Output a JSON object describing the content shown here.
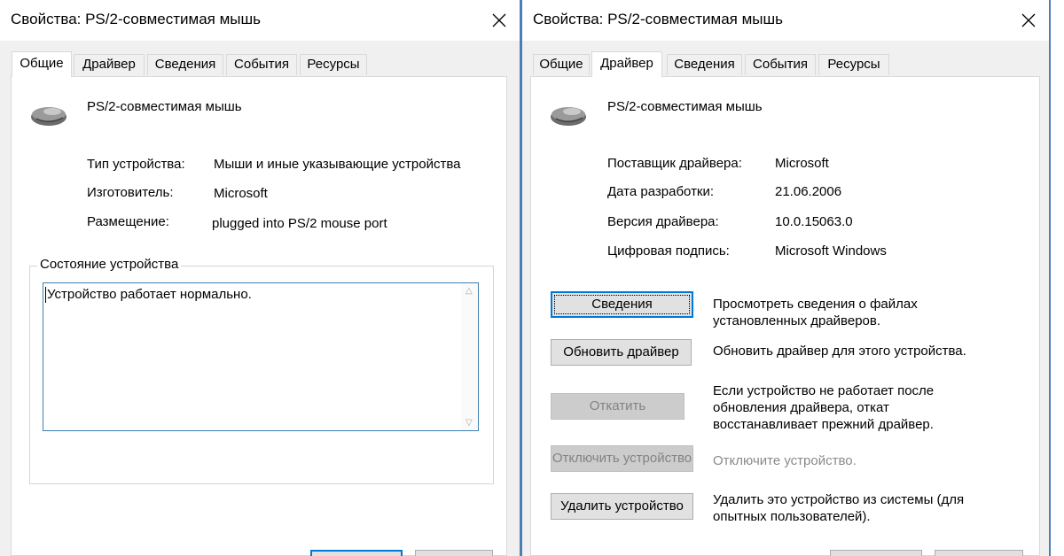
{
  "left": {
    "title": "Свойства: PS/2-совместимая мышь",
    "tabs": [
      "Общие",
      "Драйвер",
      "Сведения",
      "События",
      "Ресурсы"
    ],
    "active_tab": "Общие",
    "device_name": "PS/2-совместимая мышь",
    "props": [
      {
        "label": "Тип устройства:",
        "value": "Мыши и иные указывающие устройства"
      },
      {
        "label": "Изготовитель:",
        "value": "Microsoft"
      },
      {
        "label": "Размещение:",
        "value": "plugged into PS/2 mouse port"
      }
    ],
    "status_group_label": "Состояние устройства",
    "status_text": "Устройство работает нормально."
  },
  "right": {
    "title": "Свойства: PS/2-совместимая мышь",
    "tabs": [
      "Общие",
      "Драйвер",
      "Сведения",
      "События",
      "Ресурсы"
    ],
    "active_tab": "Драйвер",
    "device_name": "PS/2-совместимая мышь",
    "props": [
      {
        "label": "Поставщик драйвера:",
        "value": "Microsoft"
      },
      {
        "label": "Дата разработки:",
        "value": "21.06.2006"
      },
      {
        "label": "Версия драйвера:",
        "value": "10.0.15063.0"
      },
      {
        "label": "Цифровая подпись:",
        "value": "Microsoft Windows"
      }
    ],
    "actions": [
      {
        "button": "Сведения",
        "description": "Просмотреть сведения о файлах установленных драйверов.",
        "enabled": true
      },
      {
        "button": "Обновить драйвер",
        "description": "Обновить драйвер для этого устройства.",
        "enabled": true
      },
      {
        "button": "Откатить",
        "description": "Если устройство не работает после обновления драйвера, откат восстанавливает прежний драйвер.",
        "enabled": false
      },
      {
        "button": "Отключить устройство",
        "description": "Отключите устройство.",
        "enabled": false
      },
      {
        "button": "Удалить устройство",
        "description": "Удалить это устройство из системы (для опытных пользователей).",
        "enabled": true
      }
    ]
  },
  "icons": {
    "close": "close-icon",
    "device": "mouse-icon",
    "scroll_up": "scroll-up-arrow-icon",
    "scroll_down": "scroll-down-arrow-icon"
  },
  "colors": {
    "accent": "#0078d7",
    "window_border": "#4a7fb5",
    "disabled_text": "#838383"
  }
}
